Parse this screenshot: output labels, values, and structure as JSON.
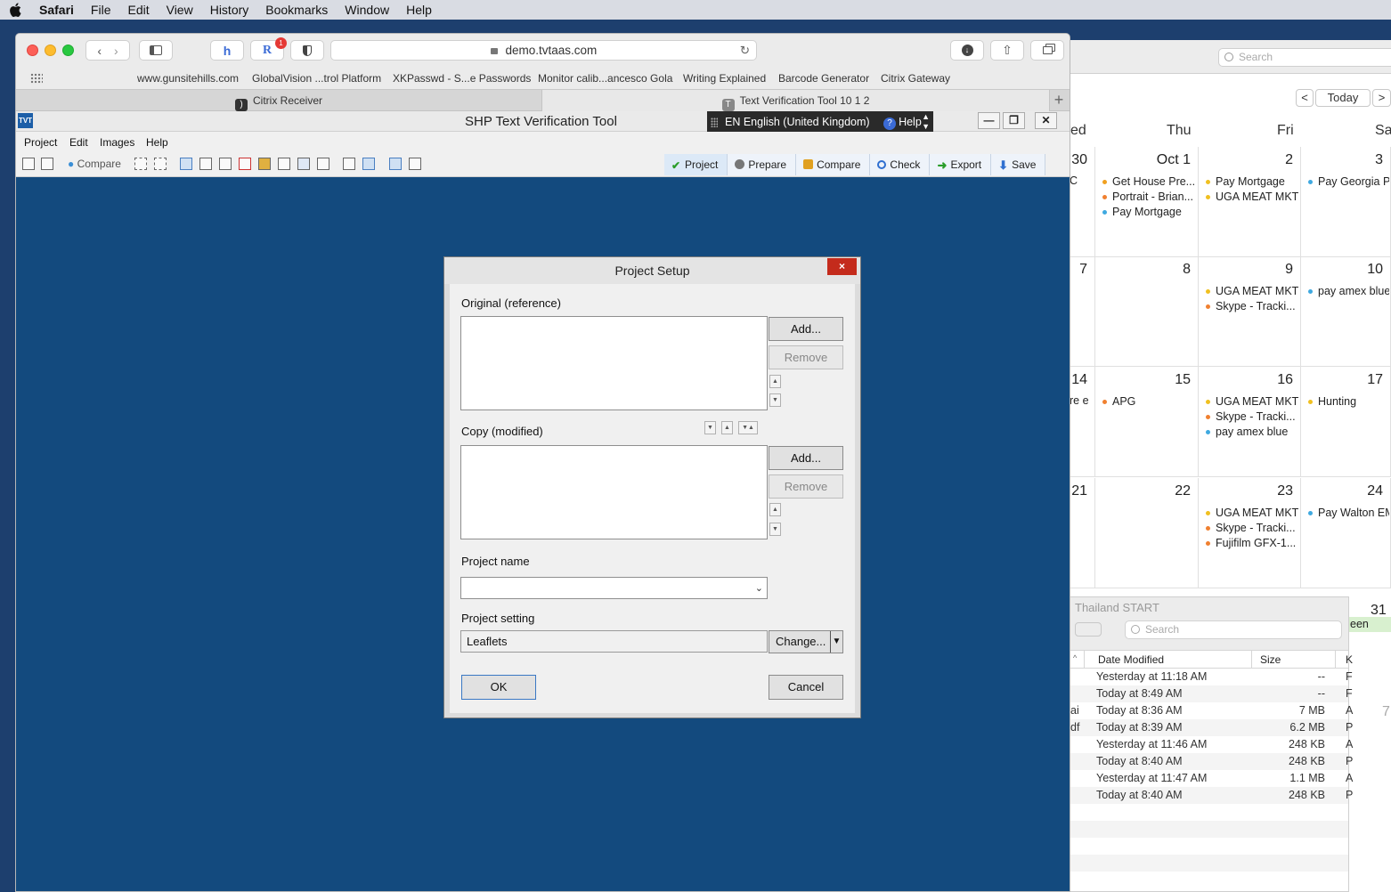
{
  "menubar": {
    "app": "Safari",
    "items": [
      "File",
      "Edit",
      "View",
      "History",
      "Bookmarks",
      "Window",
      "Help"
    ]
  },
  "calendar": {
    "search_placeholder": "Search",
    "today": "Today",
    "nav_prev": "<",
    "nav_next": ">",
    "day_headers": [
      "ed",
      "Thu",
      "Fri",
      "Sa"
    ],
    "weeks": [
      {
        "num": "30",
        "side": "C",
        "cells": [
          {
            "num": "Oct 1",
            "events": [
              {
                "t": "Get House Pre...",
                "c": "#f0a020"
              },
              {
                "t": "Portrait - Brian...",
                "c": "#f08030"
              },
              {
                "t": "Pay Mortgage",
                "c": "#3fa9e0"
              }
            ]
          },
          {
            "num": "2",
            "events": [
              {
                "t": "Pay Mortgage",
                "c": "#f0c020"
              },
              {
                "t": "UGA MEAT MKT",
                "c": "#f0c020"
              }
            ]
          },
          {
            "num": "3",
            "events": [
              {
                "t": "Pay Georgia P...",
                "c": "#3fa9e0"
              }
            ]
          }
        ]
      },
      {
        "num": "7",
        "side": "",
        "cells": [
          {
            "num": "8",
            "events": []
          },
          {
            "num": "9",
            "events": [
              {
                "t": "UGA MEAT MKT",
                "c": "#f0c020"
              },
              {
                "t": "Skype - Tracki...",
                "c": "#f08030"
              }
            ]
          },
          {
            "num": "10",
            "events": [
              {
                "t": "pay amex blue",
                "c": "#3fa9e0"
              }
            ]
          }
        ]
      },
      {
        "num": "14",
        "side": "re e",
        "cells": [
          {
            "num": "15",
            "events": [
              {
                "t": "APG",
                "c": "#f08030"
              }
            ]
          },
          {
            "num": "16",
            "events": [
              {
                "t": "UGA MEAT MKT",
                "c": "#f0c020"
              },
              {
                "t": "Skype - Tracki...",
                "c": "#f08030"
              },
              {
                "t": "pay amex blue",
                "c": "#3fa9e0"
              }
            ]
          },
          {
            "num": "17",
            "events": [
              {
                "t": "Hunting",
                "c": "#f0c020"
              }
            ]
          }
        ]
      },
      {
        "num": "21",
        "side": "",
        "cells": [
          {
            "num": "22",
            "events": []
          },
          {
            "num": "23",
            "events": [
              {
                "t": "UGA MEAT MKT",
                "c": "#f0c020"
              },
              {
                "t": "Skype - Tracki...",
                "c": "#f08030"
              },
              {
                "t": "Fujifilm  GFX-1...",
                "c": "#f08030"
              }
            ]
          },
          {
            "num": "24",
            "events": [
              {
                "t": "Pay Walton EM...",
                "c": "#3fa9e0"
              }
            ]
          }
        ]
      }
    ],
    "last_row_num": "31",
    "last_row_event": "een",
    "last_side_num": "7"
  },
  "finder": {
    "title": "Thailand START",
    "search_placeholder": "Search",
    "columns": [
      "Date Modified",
      "Size",
      "K"
    ],
    "rows": [
      {
        "pre": "",
        "date": "Yesterday at 11:18 AM",
        "size": "--",
        "kind": "F"
      },
      {
        "pre": "",
        "date": "Today at 8:49 AM",
        "size": "--",
        "kind": "F"
      },
      {
        "pre": "ai",
        "date": "Today at 8:36 AM",
        "size": "7 MB",
        "kind": "A"
      },
      {
        "pre": "df",
        "date": "Today at 8:39 AM",
        "size": "6.2 MB",
        "kind": "P"
      },
      {
        "pre": "",
        "date": "Yesterday at 11:46 AM",
        "size": "248 KB",
        "kind": "A"
      },
      {
        "pre": "",
        "date": "Today at 8:40 AM",
        "size": "248 KB",
        "kind": "P"
      },
      {
        "pre": "",
        "date": "Yesterday at 11:47 AM",
        "size": "1.1 MB",
        "kind": "A"
      },
      {
        "pre": "",
        "date": "Today at 8:40 AM",
        "size": "248 KB",
        "kind": "P"
      }
    ]
  },
  "safari": {
    "url": "demo.tvtaas.com",
    "badge": "1",
    "bookmarks": [
      "www.gunsitehills.com",
      "GlobalVision ...trol Platform",
      "XKPasswd - S...e Passwords",
      "Monitor calib...ancesco Gola",
      "Writing Explained",
      "Barcode Generator",
      "Citrix Gateway"
    ],
    "tabs": [
      {
        "label": "Citrix Receiver",
        "icon": "citrix-icon"
      },
      {
        "label": "Text Verification Tool 10 1 2",
        "icon": "T"
      }
    ],
    "new_tab": "+"
  },
  "app": {
    "title": "SHP Text Verification Tool",
    "logo": "TVT",
    "language": "EN English (United Kingdom)",
    "help": "Help",
    "help_glyph": "?",
    "menu": [
      "Project",
      "Edit",
      "Images",
      "Help"
    ],
    "compare_tool": "Compare",
    "workflow": [
      {
        "label": "Project",
        "color": "#2a9d2a"
      },
      {
        "label": "Prepare",
        "color": "#777777"
      },
      {
        "label": "Compare",
        "color": "#e0a020"
      },
      {
        "label": "Check",
        "color": "#2f6fd0"
      },
      {
        "label": "Export",
        "color": "#2a9d2a"
      },
      {
        "label": "Save",
        "color": "#2f6fd0"
      }
    ]
  },
  "dialog": {
    "title": "Project Setup",
    "close": "×",
    "original_label": "Original (reference)",
    "copy_label": "Copy (modified)",
    "add": "Add...",
    "remove": "Remove",
    "project_name_label": "Project name",
    "project_name_value": "",
    "project_setting_label": "Project setting",
    "project_setting_value": "Leaflets",
    "change": "Change...",
    "ok": "OK",
    "cancel": "Cancel"
  }
}
